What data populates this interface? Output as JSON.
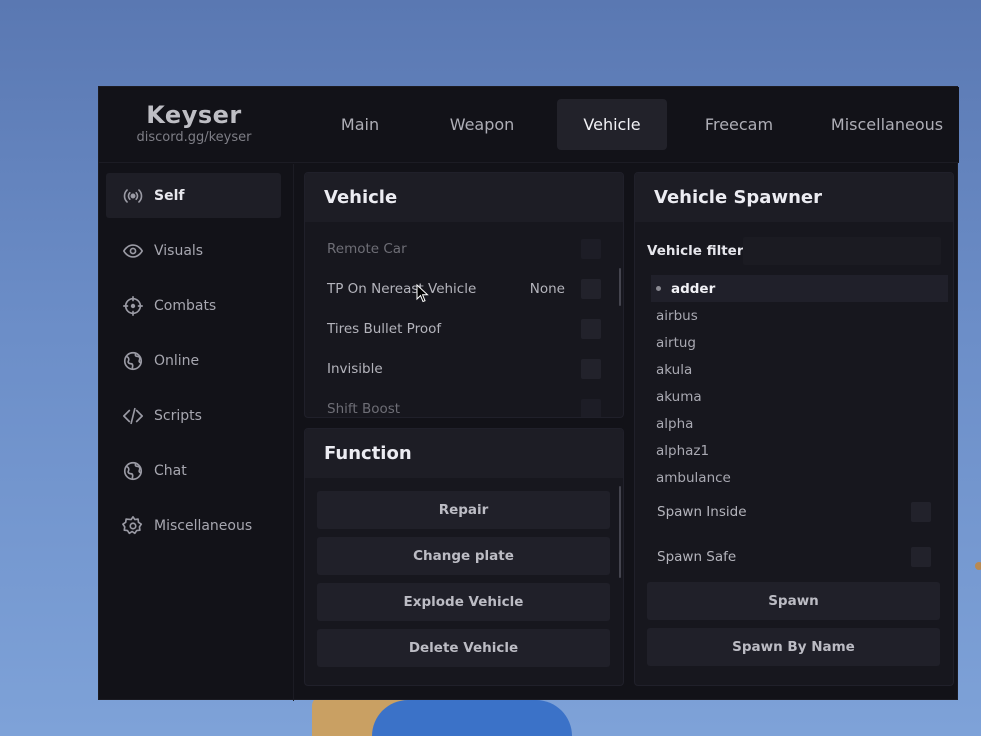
{
  "brand": {
    "title": "Keyser",
    "subtitle": "discord.gg/keyser"
  },
  "tabs": [
    {
      "label": "Main"
    },
    {
      "label": "Weapon"
    },
    {
      "label": "Vehicle",
      "active": true
    },
    {
      "label": "Freecam"
    },
    {
      "label": "Miscellaneous"
    }
  ],
  "sidebar": {
    "items": [
      {
        "label": "Self",
        "icon": "broadcast-icon",
        "active": true
      },
      {
        "label": "Visuals",
        "icon": "eye-icon"
      },
      {
        "label": "Combats",
        "icon": "crosshair-icon"
      },
      {
        "label": "Online",
        "icon": "globe-icon"
      },
      {
        "label": "Scripts",
        "icon": "code-icon"
      },
      {
        "label": "Chat",
        "icon": "globe-icon"
      },
      {
        "label": "Miscellaneous",
        "icon": "gear-icon"
      }
    ]
  },
  "vehicle_panel": {
    "title": "Vehicle",
    "options": [
      {
        "label": "Remote Car",
        "checked": false
      },
      {
        "label": "TP On Nereast Vehicle",
        "value": "None",
        "checked": false
      },
      {
        "label": "Tires Bullet Proof",
        "checked": false
      },
      {
        "label": "Invisible",
        "checked": false
      },
      {
        "label": "Shift Boost",
        "checked": false
      }
    ]
  },
  "function_panel": {
    "title": "Function",
    "buttons": [
      {
        "label": "Repair"
      },
      {
        "label": "Change plate"
      },
      {
        "label": "Explode Vehicle"
      },
      {
        "label": "Delete Vehicle"
      }
    ]
  },
  "spawner_panel": {
    "title": "Vehicle Spawner",
    "filter_label": "Vehicle filter",
    "filter_value": "",
    "vehicles": [
      "adder",
      "airbus",
      "airtug",
      "akula",
      "akuma",
      "alpha",
      "alphaz1",
      "ambulance"
    ],
    "selected_vehicle": "adder",
    "spawn_inside_label": "Spawn Inside",
    "spawn_safe_label": "Spawn Safe",
    "spawn_button": "Spawn",
    "spawn_by_name_button": "Spawn By Name"
  },
  "colors": {
    "background_sky": "#6c8ec8",
    "menu_bg": "#121218",
    "panel_bg": "#17171e",
    "accent_active": "#22222a"
  }
}
